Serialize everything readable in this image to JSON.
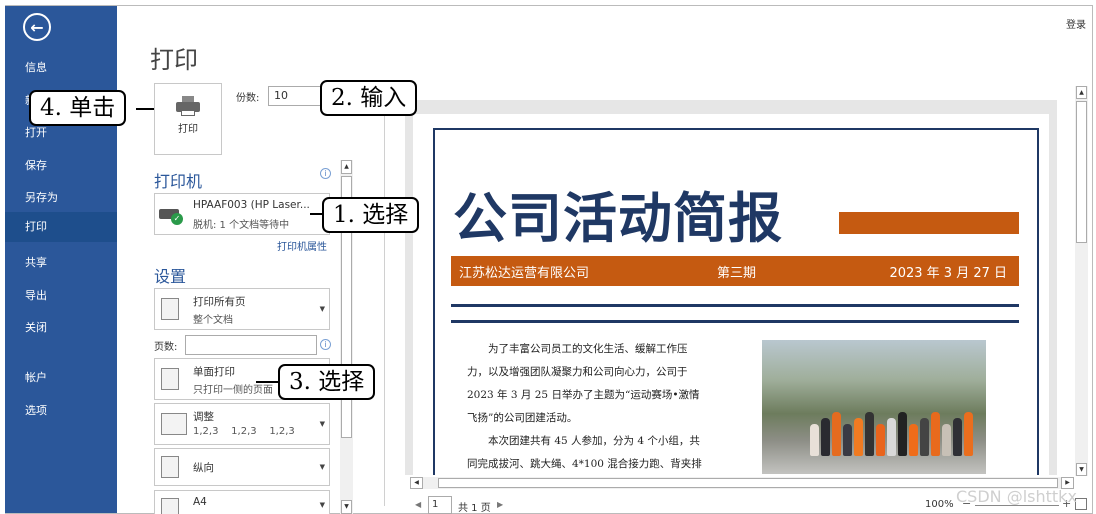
{
  "nav": {
    "back_icon": "back-arrow-icon",
    "items": [
      "信息",
      "新建",
      "打开",
      "保存",
      "另存为",
      "打印",
      "共享",
      "导出",
      "关闭",
      "帐户",
      "选项"
    ],
    "active_index": 5,
    "active_color": "#1e4e8c",
    "bg_color": "#2b579a"
  },
  "header": {
    "signin": "登录",
    "title": "打印"
  },
  "print_button": {
    "label": "打印",
    "icon": "printer-icon"
  },
  "copies": {
    "label": "份数:",
    "value": "10"
  },
  "printer": {
    "heading": "打印机",
    "name": "HPAAF003 (HP Laser...",
    "status": "脱机: 1 个文档等待中",
    "properties_link": "打印机属性"
  },
  "settings": {
    "heading": "设置",
    "print_range": {
      "title": "打印所有页",
      "subtitle": "整个文档"
    },
    "pages_label": "页数:",
    "sides": {
      "title": "单面打印",
      "subtitle": "只打印一侧的页面"
    },
    "collate": {
      "title": "调整",
      "subtitle": "1,2,3    1,2,3    1,2,3"
    },
    "orientation": {
      "title": "纵向"
    },
    "paper": {
      "title": "A4"
    }
  },
  "document": {
    "title": "公司活动简报",
    "company": "江苏松达运营有限公司",
    "issue": "第三期",
    "date": "2023 年 3 月 27 日",
    "paragraphs": [
      "为了丰富公司员工的文化生活、缓解工作压",
      "力，以及增强团队凝聚力和公司向心力，公司于",
      "2023 年 3 月 25 日举办了主题为“运动赛场•激情",
      "飞扬”的公司团建活动。",
      "本次团建共有 45 人参加，分为 4 个小组，共",
      "同完成拔河、跳大绳、4*100 混合接力跑、背夹排"
    ],
    "paragraph_indent": [
      true,
      false,
      false,
      false,
      true,
      false
    ],
    "accent_color": "#c55a11",
    "navy_color": "#1f3864"
  },
  "pager": {
    "page": "1",
    "total": "共 1 页",
    "prev_icon": "prev-page-icon",
    "next_icon": "next-page-icon"
  },
  "zoom": {
    "value": "100%",
    "minus": "−",
    "plus": "+"
  },
  "callouts": {
    "click": "4. 单击",
    "input": "2. 输入",
    "select1": "1. 选择",
    "select3": "3. 选择"
  },
  "watermark": "CSDN @lshttkx"
}
